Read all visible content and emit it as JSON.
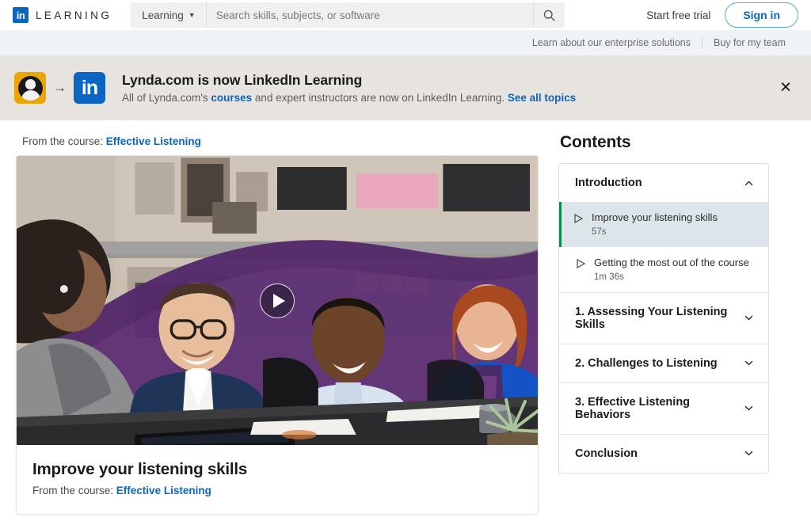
{
  "topnav": {
    "logo_icon": "linkedin-logo-icon",
    "logo_text": "in",
    "brand_word": "LEARNING",
    "dropdown_label": "Learning",
    "dropdown_icon": "caret-down-icon",
    "search_placeholder": "Search skills, subjects, or software",
    "search_value": "",
    "search_icon": "search-icon",
    "free_trial_label": "Start free trial",
    "sign_in_label": "Sign in"
  },
  "enterprise_bar": {
    "link_1": "Learn about our enterprise solutions",
    "link_2": "Buy for my team"
  },
  "banner": {
    "lynda_logo_icon": "lynda-face-icon",
    "arrow_icon": "arrow-right-icon",
    "linkedin_logo_icon": "linkedin-logo-icon",
    "linkedin_logo_text": "in",
    "title": "Lynda.com is now LinkedIn Learning",
    "sub_before": "All of Lynda.com's ",
    "sub_link_1": "courses",
    "sub_middle": " and expert instructors are now on LinkedIn Learning. ",
    "sub_link_2": "See all topics",
    "close_icon": "close-icon",
    "close_label": "✕"
  },
  "video": {
    "from_course_prefix": "From the course: ",
    "from_course_link": "Effective Listening",
    "play_icon": "play-triangle-icon",
    "title": "Improve your listening skills",
    "caption_prefix": "From the course: ",
    "caption_link": "Effective Listening"
  },
  "contents": {
    "heading": "Contents",
    "sections": [
      {
        "label": "Introduction",
        "expanded": true,
        "chevron_icon": "chevron-up-icon",
        "lessons": [
          {
            "title": "Improve your listening skills",
            "duration": "57s",
            "active": true,
            "play_icon": "play-outline-icon"
          },
          {
            "title": "Getting the most out of the course",
            "duration": "1m 36s",
            "active": false,
            "play_icon": "play-outline-icon"
          }
        ]
      },
      {
        "label": "1. Assessing Your Listening Skills",
        "expanded": false,
        "chevron_icon": "chevron-down-icon",
        "lessons": []
      },
      {
        "label": "2. Challenges to Listening",
        "expanded": false,
        "chevron_icon": "chevron-down-icon",
        "lessons": []
      },
      {
        "label": "3. Effective Listening Behaviors",
        "expanded": false,
        "chevron_icon": "chevron-down-icon",
        "lessons": []
      },
      {
        "label": "Conclusion",
        "expanded": false,
        "chevron_icon": "chevron-down-icon",
        "lessons": []
      }
    ]
  },
  "colors": {
    "brand_blue": "#0a66c2",
    "lynda_gold": "#eda600",
    "active_green": "#0e8a4f",
    "banner_bg": "#e7e3de",
    "enterprise_bg": "#f0f3f6",
    "video_accent_purple": "#5b2d73"
  }
}
